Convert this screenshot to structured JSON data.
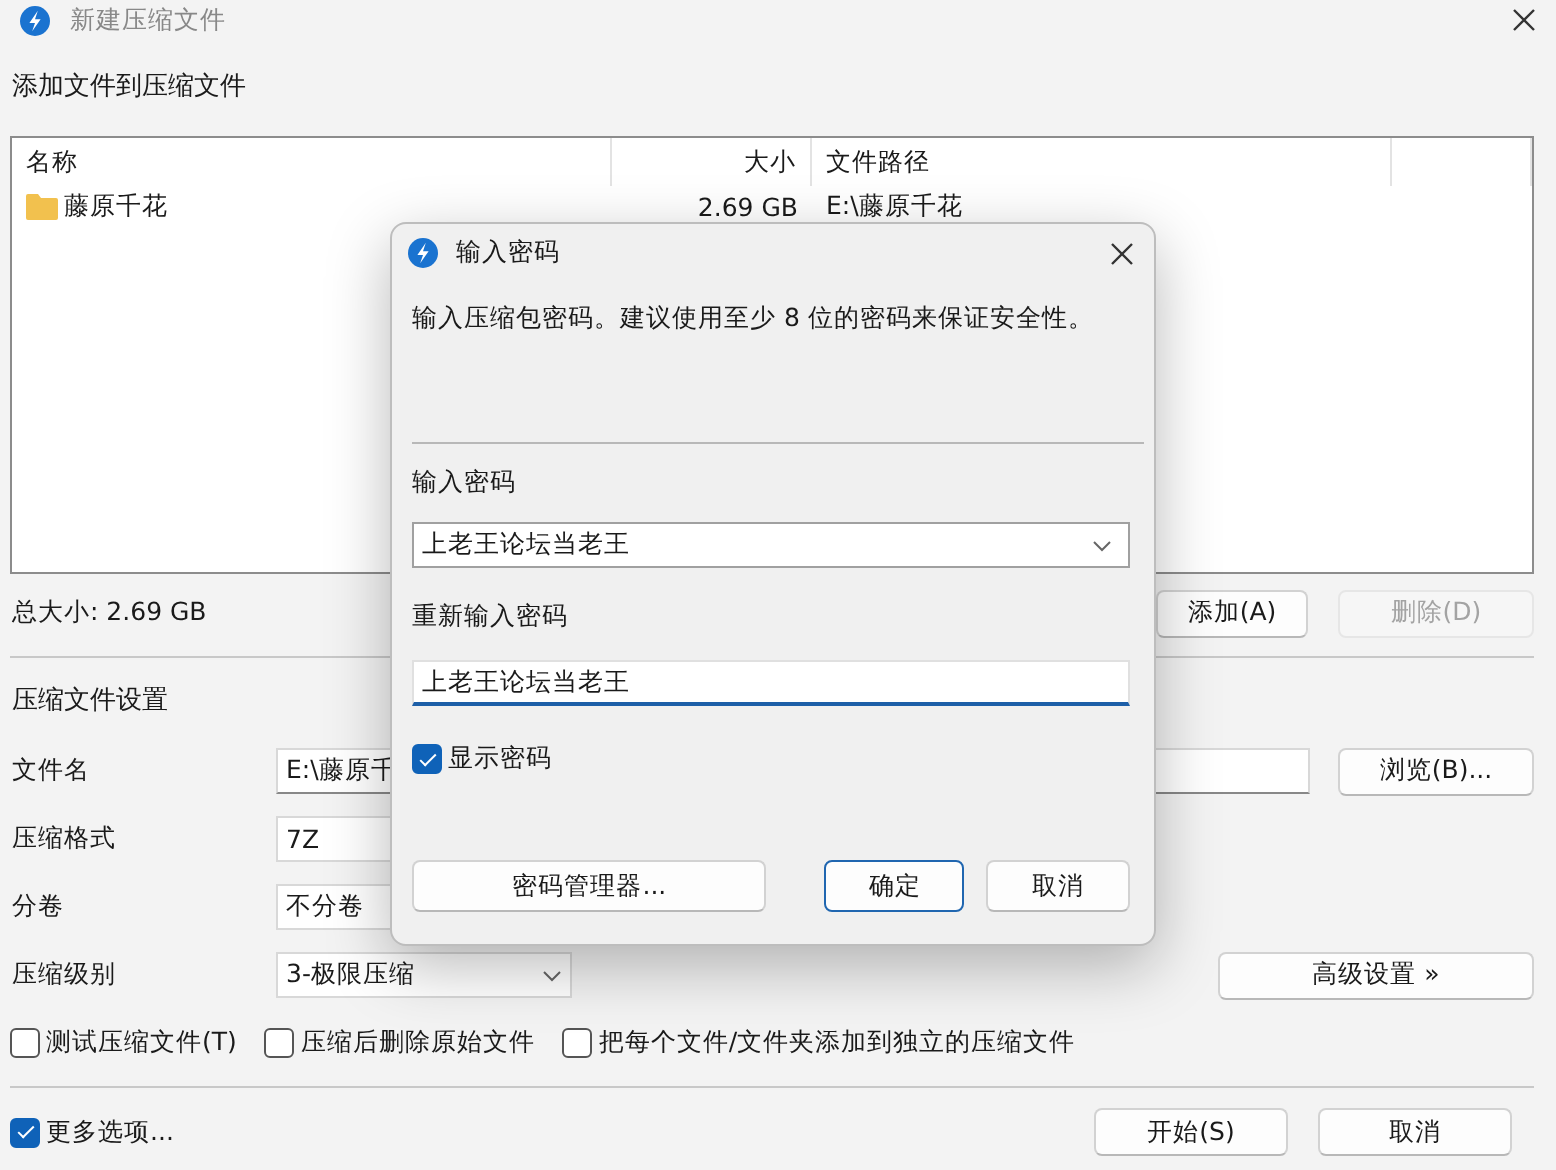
{
  "window": {
    "title": "新建压缩文件"
  },
  "files_section": {
    "heading": "添加文件到压缩文件",
    "columns": [
      "名称",
      "大小",
      "文件路径"
    ],
    "rows": [
      {
        "name": "藤原千花",
        "size": "2.69 GB",
        "path": "E:\\藤原千花"
      }
    ],
    "total": "总大小: 2.69 GB",
    "buttons": [
      {
        "label": "添加(A)",
        "disabled": false
      },
      {
        "label": "删除(D)",
        "disabled": true
      }
    ]
  },
  "settings": {
    "heading": "压缩文件设置",
    "fields": [
      {
        "label": "文件名",
        "value": "E:\\藤原千",
        "kind": "text"
      },
      {
        "label": "压缩格式",
        "value": "7Z",
        "kind": "box"
      },
      {
        "label": "分卷",
        "value": "不分卷",
        "kind": "box"
      },
      {
        "label": "压缩级别",
        "value": "3-极限压缩",
        "kind": "select"
      }
    ],
    "browse_button": "浏览(B)...",
    "advanced_button": "高级设置 »",
    "options": [
      {
        "label": "测试压缩文件(T)",
        "checked": false
      },
      {
        "label": "压缩后删除原始文件",
        "checked": false
      },
      {
        "label": "把每个文件/文件夹添加到独立的压缩文件",
        "checked": false
      }
    ]
  },
  "footer": {
    "more_options": {
      "label": "更多选项...",
      "checked": true
    },
    "buttons": [
      "开始(S)",
      "取消"
    ]
  },
  "password_dialog": {
    "title": "输入密码",
    "message": "输入压缩包密码。建议使用至少 8 位的密码来保证安全性。",
    "password_label": "输入密码",
    "password_value": "上老王论坛当老王",
    "confirm_label": "重新输入密码",
    "confirm_value": "上老王论坛当老王",
    "confirm_focused": true,
    "show_password": {
      "label": "显示密码",
      "checked": true
    },
    "buttons": [
      {
        "label": "密码管理器...",
        "default": false
      },
      {
        "label": "确定",
        "default": true
      },
      {
        "label": "取消",
        "default": false
      }
    ]
  }
}
